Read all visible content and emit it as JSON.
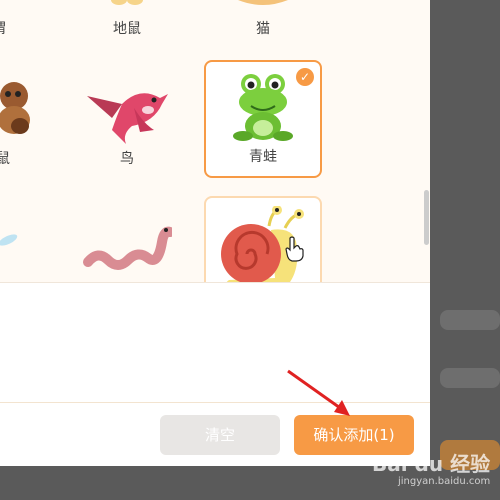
{
  "grid": {
    "row1": [
      {
        "label": "猬"
      },
      {
        "label": "地鼠"
      },
      {
        "label": "猫"
      }
    ],
    "row2": [
      {
        "label": "鼠"
      },
      {
        "label": "鸟"
      },
      {
        "label": "青蛙",
        "selected": true
      }
    ],
    "row3": [
      {
        "label": ""
      },
      {
        "label": ""
      },
      {
        "label": ""
      }
    ]
  },
  "footer": {
    "clear_label": "清空",
    "confirm_label": "确认添加(1)"
  },
  "watermark": {
    "brand": "Bai du 经验",
    "url": "jingyan.baidu.com"
  },
  "colors": {
    "accent": "#f79a45",
    "muted_button": "#e8e6e4",
    "selected_border": "#f79a45"
  }
}
